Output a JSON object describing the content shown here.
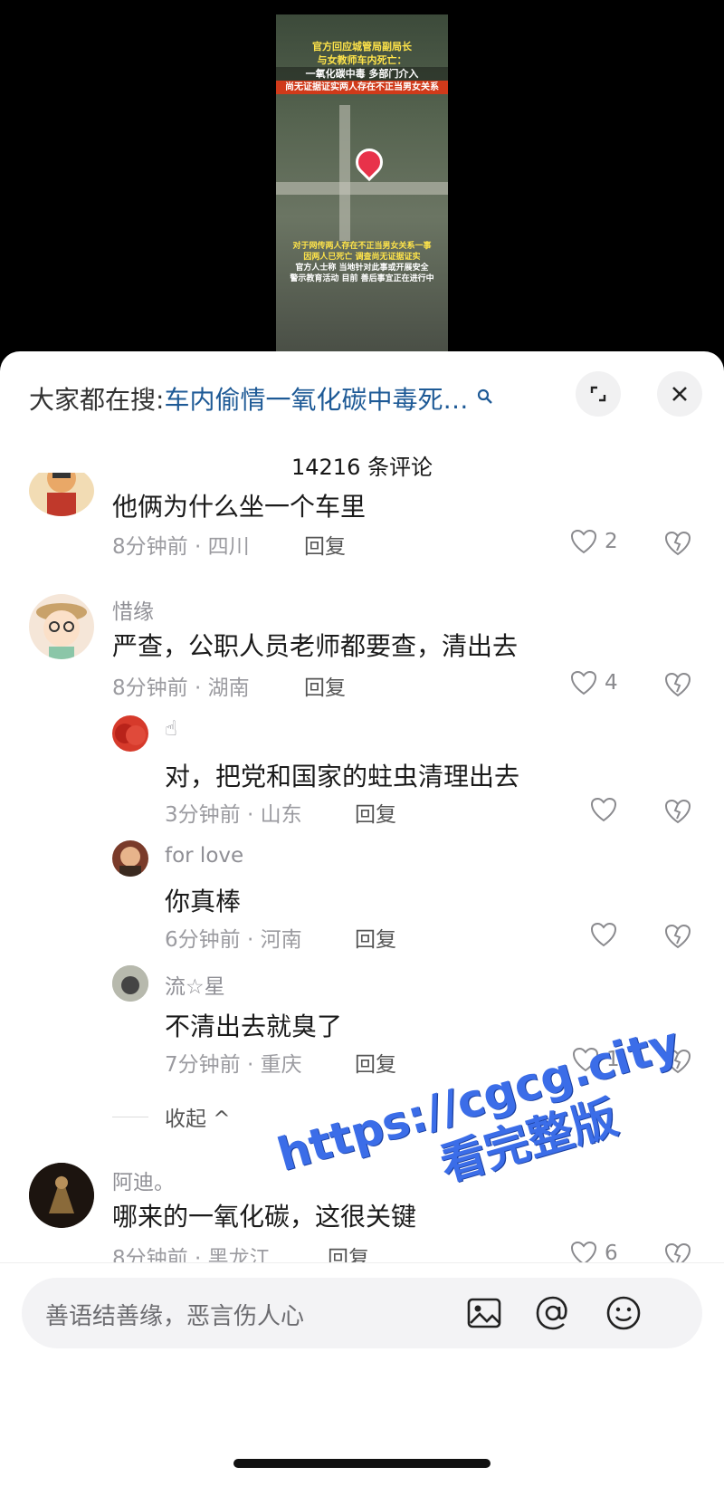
{
  "video": {
    "headline": [
      "官方回应城管局副局长",
      "与女教师车内死亡：",
      "一氧化碳中毒 多部门介入",
      "尚无证据证实两人存在不正当男女关系"
    ],
    "caption": [
      "对于网传两人存在不正当男女关系一事",
      "因两人已死亡 调查尚无证据证实",
      "官方人士称 当地针对此事或开展安全",
      "警示教育活动 目前 善后事宜正在进行中"
    ]
  },
  "search": {
    "prefix": "大家都在搜:",
    "term": "车内偷情一氧化碳中毒死…",
    "icon": "search-icon"
  },
  "header": {
    "count": "14216 条评论",
    "expand_icon": "expand-icon",
    "close_icon": "close-icon"
  },
  "comments": [
    {
      "text": "他俩为什么坐一个车里",
      "time_loc": "8分钟前 · 四川",
      "reply": "回复",
      "likes": "2"
    },
    {
      "user": "惜缘",
      "text": "严查，公职人员老师都要查，清出去",
      "time_loc": "8分钟前 · 湖南",
      "reply": "回复",
      "likes": "4"
    },
    {
      "user": "☝",
      "text": "对，把党和国家的蛀虫清理出去",
      "time_loc": "3分钟前 · 山东",
      "reply": "回复",
      "likes": ""
    },
    {
      "user": "for love",
      "text": "你真棒",
      "time_loc": "6分钟前 · 河南",
      "reply": "回复",
      "likes": ""
    },
    {
      "user": "流☆星",
      "text": "不清出去就臭了",
      "time_loc": "7分钟前 · 重庆",
      "reply": "回复",
      "likes": "1"
    },
    {
      "user": "阿迪。",
      "text": "哪来的一氧化碳，这很关键",
      "time_loc": "8分钟前 · 黑龙江",
      "reply": "回复",
      "likes": "6"
    }
  ],
  "collapse_label": "收起 ^",
  "watermark": {
    "line1": "https://cgcg.city",
    "line2": "看完整版"
  },
  "input": {
    "placeholder": "善语结善缘，恶言伤人心",
    "icons": [
      "image-icon",
      "at-icon",
      "emoji-icon"
    ]
  },
  "colors": {
    "link_blue": "#1e5a96",
    "watermark_blue": "#3b6de8"
  }
}
